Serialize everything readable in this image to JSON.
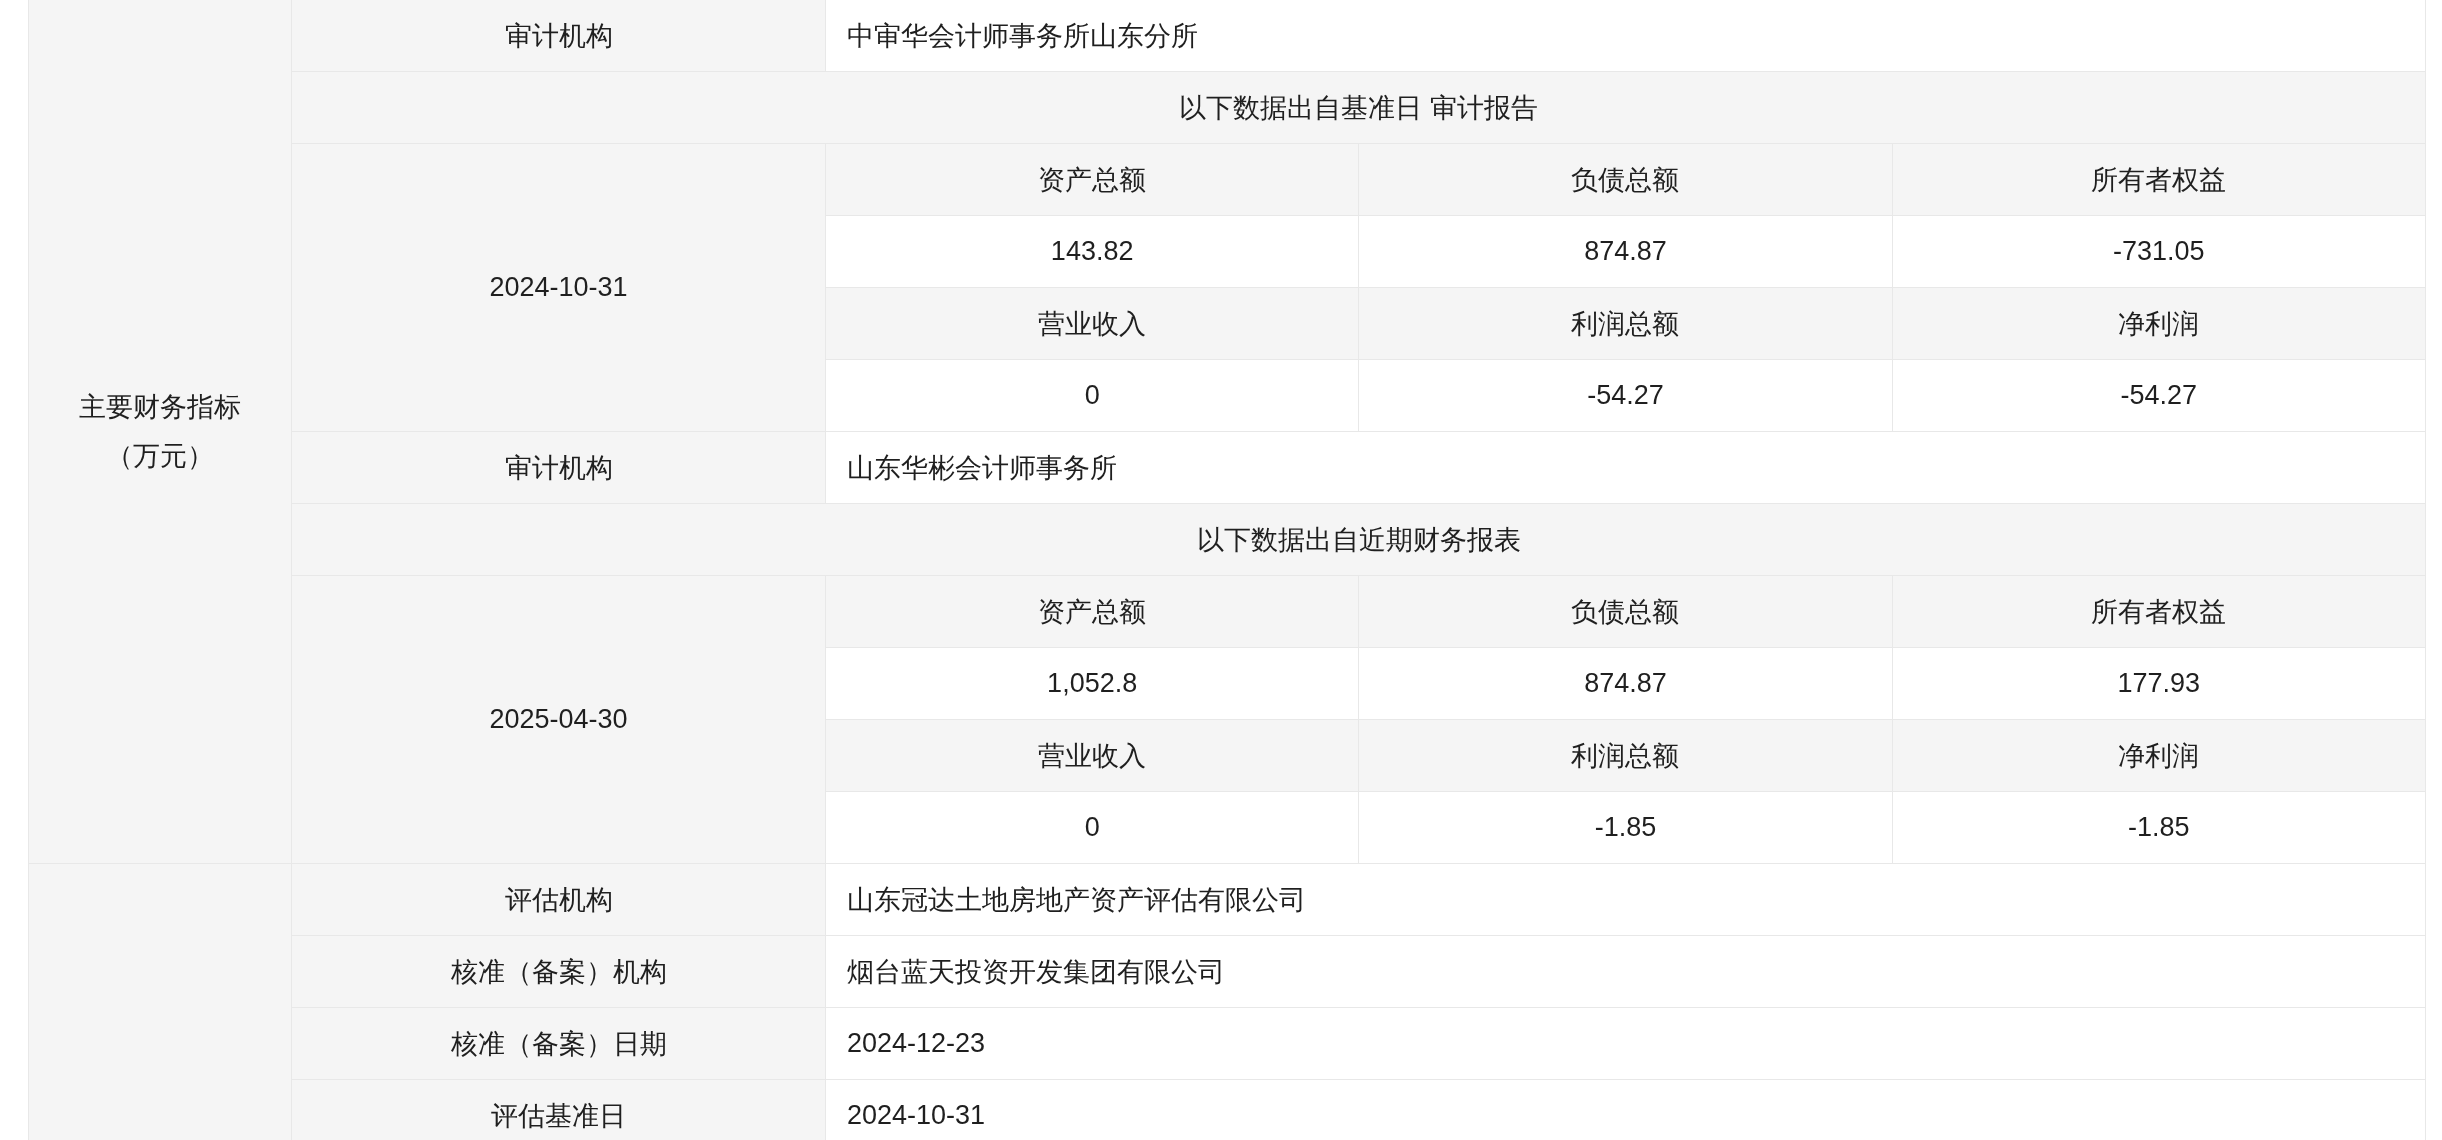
{
  "financials": {
    "label": "主要财务指标（万元）",
    "reports": [
      {
        "auditor_label": "审计机构",
        "auditor": "中审华会计师事务所山东分所",
        "source": "以下数据出自基准日 审计报告",
        "date": "2024-10-31",
        "metrics": [
          {
            "label": "资产总额",
            "value": "143.82"
          },
          {
            "label": "负债总额",
            "value": "874.87"
          },
          {
            "label": "所有者权益",
            "value": "-731.05"
          },
          {
            "label": "营业收入",
            "value": "0"
          },
          {
            "label": "利润总额",
            "value": "-54.27"
          },
          {
            "label": "净利润",
            "value": "-54.27"
          }
        ]
      },
      {
        "auditor_label": "审计机构",
        "auditor": "山东华彬会计师事务所",
        "source": "以下数据出自近期财务报表",
        "date": "2025-04-30",
        "metrics": [
          {
            "label": "资产总额",
            "value": "1,052.8"
          },
          {
            "label": "负债总额",
            "value": "874.87"
          },
          {
            "label": "所有者权益",
            "value": "177.93"
          },
          {
            "label": "营业收入",
            "value": "0"
          },
          {
            "label": "利润总额",
            "value": "-1.85"
          },
          {
            "label": "净利润",
            "value": "-1.85"
          }
        ]
      }
    ]
  },
  "valuation": {
    "rows": [
      {
        "label": "评估机构",
        "value": "山东冠达土地房地产资产评估有限公司"
      },
      {
        "label": "核准（备案）机构",
        "value": "烟台蓝天投资开发集团有限公司"
      },
      {
        "label": "核准（备案）日期",
        "value": "2024-12-23"
      },
      {
        "label": "评估基准日",
        "value": "2024-10-31"
      }
    ]
  }
}
